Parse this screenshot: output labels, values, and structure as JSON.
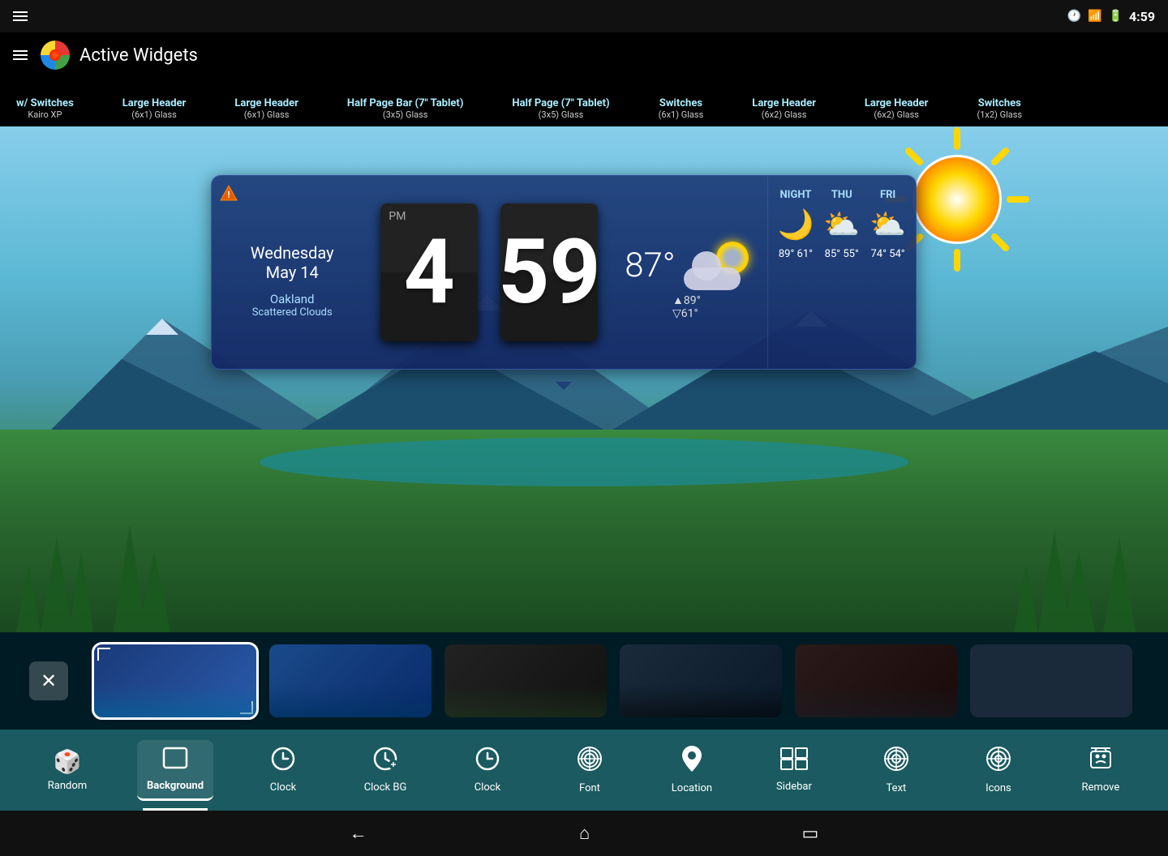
{
  "statusBar": {
    "time": "4:59",
    "icons": [
      "clock",
      "wifi",
      "battery"
    ]
  },
  "appBar": {
    "title": "Active Widgets",
    "menuIcon": "menu-icon"
  },
  "widgetList": {
    "items": [
      {
        "name": "w/ Switches",
        "desc": "Kairo XP"
      },
      {
        "name": "Large Header",
        "desc": "(6x1) Glass"
      },
      {
        "name": "Large Header",
        "desc": "(6x1) Glass"
      },
      {
        "name": "Half Page Bar (7\" Tablet)",
        "desc": "(3x5) Glass"
      },
      {
        "name": "Half Page (7\" Tablet)",
        "desc": "(3x5) Glass"
      },
      {
        "name": "Switches",
        "desc": "(6x1) Glass"
      },
      {
        "name": "Large Header",
        "desc": "(6x2) Glass"
      },
      {
        "name": "Large Header",
        "desc": "(6x2) Glass"
      },
      {
        "name": "Switches",
        "desc": "(1x2) Glass"
      }
    ]
  },
  "weather": {
    "day": "Wednesday",
    "date": "May 14",
    "city": "Oakland",
    "condition": "Scattered Clouds",
    "hour": "4",
    "minute": "59",
    "ampm": "PM",
    "currentTemp": "87°",
    "hiTemp": "▲89°",
    "loTemp": "▽61°",
    "forecast": [
      {
        "day": "NIGHT",
        "temp": "89°  61°",
        "icon": "🌙"
      },
      {
        "day": "THU",
        "temp": "85°  55°",
        "icon": "⛅"
      },
      {
        "day": "FRI",
        "temp": "74°  54°",
        "icon": "⛅"
      }
    ]
  },
  "themeCards": {
    "closeLabel": "×",
    "cards": [
      {
        "id": 1,
        "selected": true
      },
      {
        "id": 2,
        "selected": false
      },
      {
        "id": 3,
        "selected": false
      },
      {
        "id": 4,
        "selected": false
      },
      {
        "id": 5,
        "selected": false
      },
      {
        "id": 6,
        "selected": false
      }
    ]
  },
  "toolbar": {
    "items": [
      {
        "id": "random",
        "label": "Random",
        "icon": "🎲"
      },
      {
        "id": "background",
        "label": "Background",
        "icon": "⬜",
        "active": true
      },
      {
        "id": "clock",
        "label": "Clock",
        "icon": "🕐"
      },
      {
        "id": "clockbg",
        "label": "Clock BG",
        "icon": "🕐"
      },
      {
        "id": "clock2",
        "label": "Clock",
        "icon": "🕐"
      },
      {
        "id": "font",
        "label": "Font",
        "icon": "🎨"
      },
      {
        "id": "location",
        "label": "Location",
        "icon": "📍"
      },
      {
        "id": "sidebar",
        "label": "Sidebar",
        "icon": "⊞"
      },
      {
        "id": "text",
        "label": "Text",
        "icon": "🎨"
      },
      {
        "id": "icons",
        "label": "Icons",
        "icon": "🎨"
      },
      {
        "id": "remove",
        "label": "Remove",
        "icon": "👻"
      }
    ]
  },
  "navBar": {
    "back": "←",
    "home": "⌂",
    "recent": "▭"
  }
}
